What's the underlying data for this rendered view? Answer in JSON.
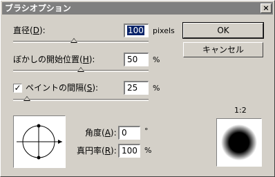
{
  "window": {
    "title": "ブラシオプション",
    "close": "×"
  },
  "diameter": {
    "label_pre": "直径(",
    "key": "D",
    "label_post": "):",
    "value": "100",
    "unit": "pixels",
    "slider_fraction": 0.45
  },
  "hardness": {
    "label_pre": "ぼかしの開始位置(",
    "key": "H",
    "label_post": "):",
    "value": "50",
    "unit": "%",
    "slider_fraction": 0.5
  },
  "spacing": {
    "checked": "✓",
    "label_pre": "ペイントの間隔(",
    "key": "S",
    "label_post": "):",
    "value": "25",
    "unit": "%",
    "slider_fraction": 0.1
  },
  "buttons": {
    "ok": "OK",
    "cancel": "キャンセル"
  },
  "angle": {
    "label_pre": "角度(",
    "key": "A",
    "label_post": "):",
    "value": "0",
    "unit": "°"
  },
  "roundness": {
    "label_pre": "真円率(",
    "key": "R",
    "label_post": "):",
    "value": "100",
    "unit": "%"
  },
  "preview": {
    "ratio": "1:2"
  }
}
